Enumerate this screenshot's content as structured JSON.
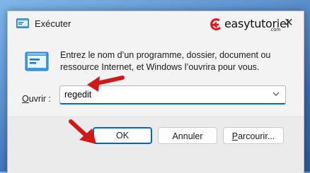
{
  "window": {
    "title": "Exécuter",
    "close_glyph": "✕"
  },
  "brand": {
    "name": "easytutoriel",
    "sub": ".com",
    "logo_color": "#e0141e"
  },
  "dialog": {
    "description": "Entrez le nom d’un programme, dossier, document ou ressource Internet, et Windows l’ouvrira pour vous.",
    "open_label_prefix": "",
    "open_label_underlined": "O",
    "open_label_rest": "uvrir :",
    "open_value": "regedit"
  },
  "buttons": {
    "ok": "OK",
    "cancel": "Annuler",
    "browse_underlined": "P",
    "browse_rest": "arcourir..."
  },
  "colors": {
    "accent": "#0067c0",
    "arrow": "#d01818"
  },
  "icons": {
    "title": "run-icon",
    "big": "run-icon",
    "caret": "chevron-down-icon"
  }
}
